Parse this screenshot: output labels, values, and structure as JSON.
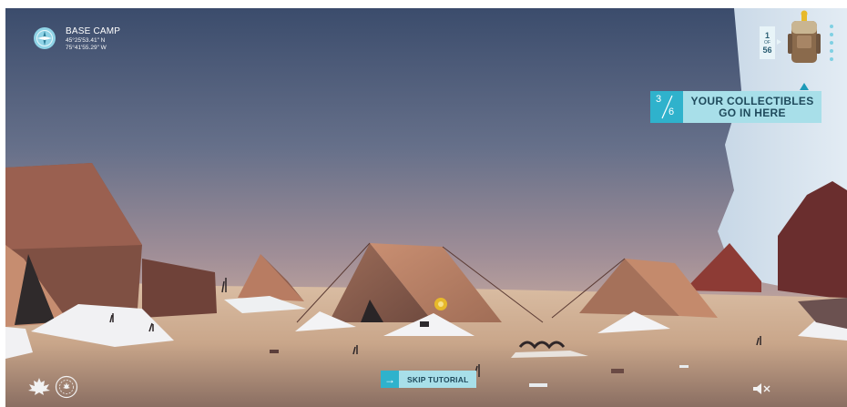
{
  "location": {
    "name": "BASE CAMP",
    "latitude": "45°25'53.41\" N",
    "longitude": "75°41'55.29\" W",
    "icon": "compass-icon"
  },
  "collectible_counter": {
    "current": "1",
    "of_label": "OF",
    "total": "56"
  },
  "tooltip": {
    "fraction_numerator": "3",
    "fraction_denominator": "6",
    "line1": "YOUR COLLECTIBLES",
    "line2": "GO IN HERE"
  },
  "skip_button": {
    "label": "SKIP TUTORIAL",
    "icon": "arrow-right-icon"
  },
  "footer": {
    "logo_icon": "maple-leaf-logo-icon",
    "seal_icon": "canada-150-seal-icon",
    "sound_icon": "speaker-muted-icon",
    "sound_muted": true
  },
  "colors": {
    "accent_dark": "#2fb2cc",
    "accent_light": "#a8dfe9",
    "text_dark": "#1f4a5c"
  }
}
